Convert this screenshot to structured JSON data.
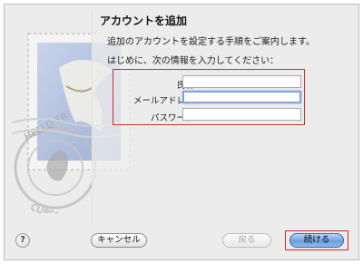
{
  "dialog": {
    "title": "アカウントを追加",
    "subtitle": "追加のアカウントを設定する手順をご案内します。",
    "instruction": "はじめに、次の情報を入力してください："
  },
  "form": {
    "name_label": "氏名：",
    "name_value": "",
    "email_label": "メールアドレス：",
    "email_value": "",
    "password_label": "パスワード：",
    "password_value": ""
  },
  "stamp": {
    "text_top": "HELLO FR",
    "text_bottom": "CUPERTINO"
  },
  "buttons": {
    "help": "?",
    "cancel": "キャンセル",
    "back": "戻る",
    "continue": "続ける"
  },
  "colors": {
    "highlight_red": "#d22b2b",
    "primary_blue": "#6e9fdd",
    "focus_blue": "#7ea6d8"
  }
}
